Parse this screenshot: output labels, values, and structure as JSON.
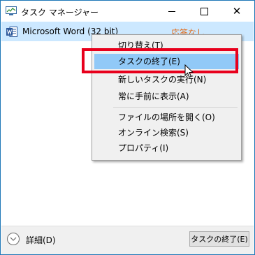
{
  "window": {
    "title": "タスク マネージャー",
    "title_icon": "task-manager-icon",
    "controls": {
      "minimize": "minimize-icon",
      "maximize": "maximize-icon",
      "close_label": "✕"
    }
  },
  "process": {
    "name": "Microsoft Word (32 bit)",
    "status": "応答なし",
    "status_color": "#e06c1b",
    "icon": "word-icon"
  },
  "context_menu": {
    "items": [
      {
        "label": "切り替え(T)"
      },
      {
        "label": "タスクの終了(E)",
        "highlighted": true
      },
      {
        "label": "新しいタスクの実行(N)"
      },
      {
        "label": "常に手前に表示(A)"
      },
      {
        "label": "ファイルの場所を開く(O)"
      },
      {
        "label": "オンライン検索(S)"
      },
      {
        "label": "プロパティ(I)"
      }
    ]
  },
  "annotation": {
    "highlight_color": "#e8001c"
  },
  "footer": {
    "details_label": "詳細(D)",
    "end_task_label": "タスクの終了(E)"
  },
  "colors": {
    "selected_row": "#cce8ff",
    "menu_highlight": "#91c9f7",
    "window_border": "#1f78b8"
  }
}
